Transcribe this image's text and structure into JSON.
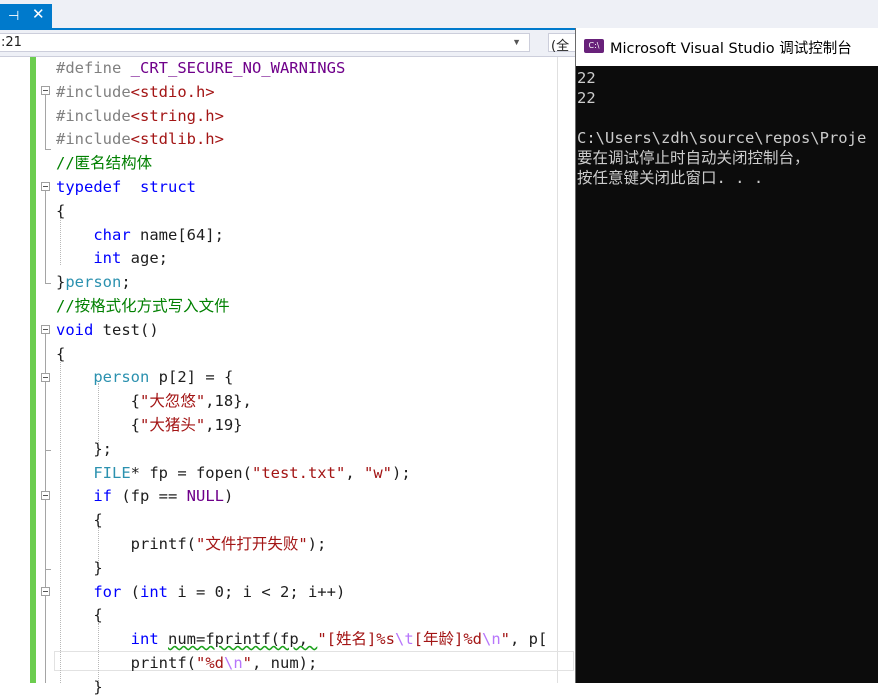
{
  "tab": {
    "pin_glyph": "⊣",
    "close_glyph": "✕"
  },
  "navbar": {
    "left_value": ":21",
    "right_value": "(全"
  },
  "code": [
    [
      [
        "pp",
        "#define "
      ],
      [
        "mc",
        "_CRT_SECURE_NO_WARNINGS"
      ]
    ],
    [
      [
        "pp",
        "#include"
      ],
      [
        "st",
        "<stdio.h>"
      ]
    ],
    [
      [
        "pp",
        "#include"
      ],
      [
        "st",
        "<string.h>"
      ]
    ],
    [
      [
        "pp",
        "#include"
      ],
      [
        "st",
        "<stdlib.h>"
      ]
    ],
    [
      [
        "cm",
        "//匿名结构体"
      ]
    ],
    [
      [
        "kw",
        "typedef"
      ],
      [
        "",
        "  "
      ],
      [
        "kw",
        "struct"
      ]
    ],
    [
      [
        "",
        "{"
      ]
    ],
    [
      [
        "",
        "    "
      ],
      [
        "kw",
        "char"
      ],
      [
        "",
        " name[64];"
      ]
    ],
    [
      [
        "",
        "    "
      ],
      [
        "kw",
        "int"
      ],
      [
        "",
        " age;"
      ]
    ],
    [
      [
        "",
        "}"
      ],
      [
        "ty",
        "person"
      ],
      [
        "",
        ";"
      ]
    ],
    [
      [
        "cm",
        "//按格式化方式写入文件"
      ]
    ],
    [
      [
        "kw",
        "void"
      ],
      [
        "",
        " test()"
      ]
    ],
    [
      [
        "",
        "{"
      ]
    ],
    [
      [
        "",
        "    "
      ],
      [
        "ty",
        "person"
      ],
      [
        "",
        " p[2] = {"
      ]
    ],
    [
      [
        "",
        "        {"
      ],
      [
        "st",
        "\"大忽悠\""
      ],
      [
        "",
        ",18},"
      ]
    ],
    [
      [
        "",
        "        {"
      ],
      [
        "st",
        "\"大猪头\""
      ],
      [
        "",
        ",19}"
      ]
    ],
    [
      [
        "",
        "    };"
      ]
    ],
    [
      [
        "",
        "    "
      ],
      [
        "ty",
        "FILE"
      ],
      [
        "",
        "* fp = fopen("
      ],
      [
        "st",
        "\"test.txt\""
      ],
      [
        "",
        ", "
      ],
      [
        "st",
        "\"w\""
      ],
      [
        "",
        ");"
      ]
    ],
    [
      [
        "",
        "    "
      ],
      [
        "kw",
        "if"
      ],
      [
        "",
        " (fp == "
      ],
      [
        "mc",
        "NULL"
      ],
      [
        "",
        ")"
      ]
    ],
    [
      [
        "",
        "    {"
      ]
    ],
    [
      [
        "",
        "        printf("
      ],
      [
        "st",
        "\"文件打开失败\""
      ],
      [
        "",
        ");"
      ]
    ],
    [
      [
        "",
        "    }"
      ]
    ],
    [
      [
        "",
        "    "
      ],
      [
        "kw",
        "for"
      ],
      [
        "",
        " ("
      ],
      [
        "kw",
        "int"
      ],
      [
        "",
        " i = 0; i < 2; i++)"
      ]
    ],
    [
      [
        "",
        "    {"
      ]
    ],
    [
      [
        "",
        "        "
      ],
      [
        "kw",
        "int"
      ],
      [
        "",
        " "
      ],
      [
        "sq",
        "num=fprintf(fp, "
      ],
      [
        "st",
        "\"[姓名]%s"
      ],
      [
        "es",
        "\\t"
      ],
      [
        "st",
        "[年龄]%d"
      ],
      [
        "es",
        "\\n"
      ],
      [
        "st",
        "\""
      ],
      [
        "",
        ", p["
      ]
    ],
    [
      [
        "",
        "        printf("
      ],
      [
        "st",
        "\"%d"
      ],
      [
        "es",
        "\\n"
      ],
      [
        "st",
        "\""
      ],
      [
        "",
        ", num);"
      ]
    ],
    [
      [
        "",
        "    }"
      ]
    ]
  ],
  "console": {
    "title": "Microsoft Visual Studio 调试控制台",
    "icon_label": "C:\\",
    "lines": [
      "22",
      "22",
      "",
      "C:\\Users\\zdh\\source\\repos\\Proje",
      "要在调试停止时自动关闭控制台，",
      "按任意键关闭此窗口. . ."
    ]
  }
}
